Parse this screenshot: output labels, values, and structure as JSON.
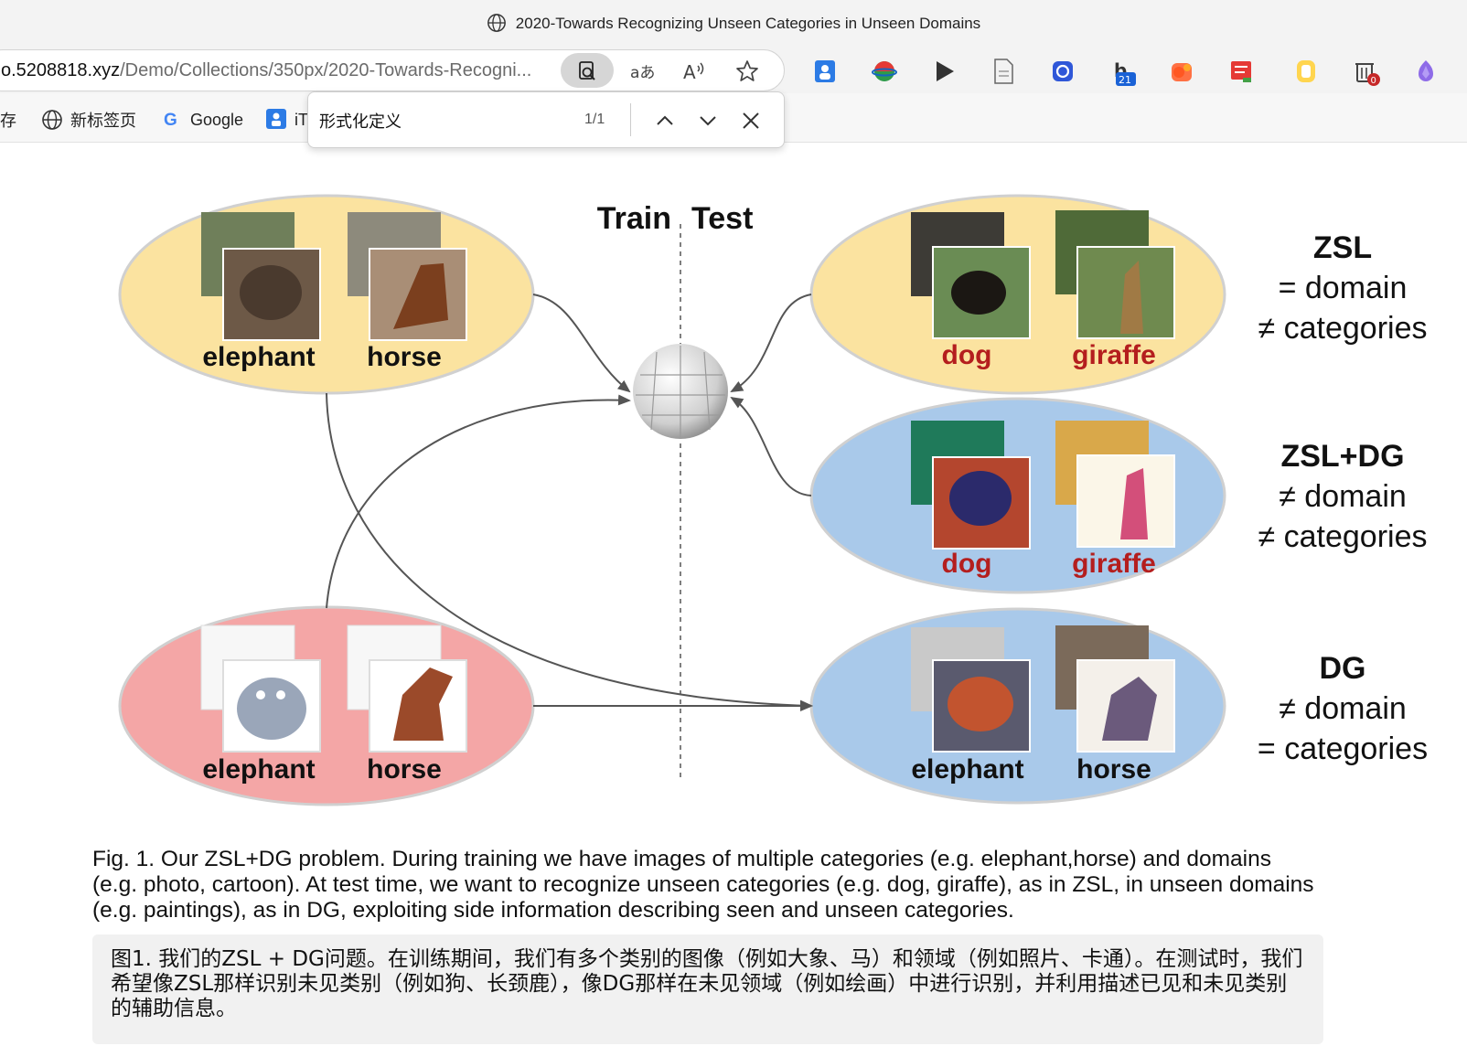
{
  "window": {
    "title": "2020-Towards Recognizing Unseen Categories in Unseen Domains",
    "title_icon": "globe-icon"
  },
  "address_bar": {
    "url_host": "o.5208818.xyz",
    "url_path": "/Demo/Collections/350px/2020-Towards-Recogni...",
    "icons": [
      "find-on-page-icon",
      "translate-icon",
      "read-aloud-icon",
      "favorite-star-icon"
    ]
  },
  "extensions": {
    "icons": [
      "person-ext-icon",
      "colorful-globe-ext-icon",
      "play-ext-icon",
      "document-ext-icon",
      "blue-chat-ext-icon",
      "b-badge-ext-icon",
      "orange-ext-icon",
      "red-list-ext-icon",
      "yellow-square-ext-icon",
      "trash-ext-icon",
      "purple-gem-ext-icon"
    ],
    "b_badge_count": "21",
    "trash_badge_count": "0",
    "badge_color": "#1a62d6",
    "trash_badge_color": "#c62828"
  },
  "bookmarks": {
    "items": [
      {
        "label": "存",
        "icon": ""
      },
      {
        "label": "新标签页",
        "icon": "globe-icon"
      },
      {
        "label": "Google",
        "icon": "google-g-icon"
      },
      {
        "label": "iT",
        "icon": "app-icon"
      }
    ]
  },
  "find_bar": {
    "query": "形式化定义",
    "match_count": "1/1",
    "icons": [
      "previous-match-icon",
      "next-match-icon",
      "close-find-icon"
    ]
  },
  "figure": {
    "train_label": "Train",
    "test_label": "Test",
    "train_photo": {
      "labels": [
        "elephant",
        "horse"
      ],
      "color": "#fbe3a0"
    },
    "train_cartoon": {
      "labels": [
        "elephant",
        "horse"
      ],
      "color": "#f4a6a6"
    },
    "test_zsl": {
      "labels": [
        "dog",
        "giraffe"
      ],
      "color": "#fbe3a0",
      "label_color": "#b41e1e"
    },
    "test_zsldg": {
      "labels": [
        "dog",
        "giraffe"
      ],
      "color": "#a9c9ea",
      "label_color": "#b41e1e"
    },
    "test_dg": {
      "labels": [
        "elephant",
        "horse"
      ],
      "color": "#a9c9ea",
      "label_color": "#111111"
    },
    "side_labels": [
      {
        "title": "ZSL",
        "line1": "= domain",
        "line2": "≠ categories"
      },
      {
        "title": "ZSL+DG",
        "line1": "≠ domain",
        "line2": "≠ categories"
      },
      {
        "title": "DG",
        "line1": "≠ domain",
        "line2": "= categories"
      }
    ]
  },
  "caption_en": "Fig. 1. Our ZSL+DG problem. During training we have images of multiple categories (e.g. elephant,horse) and domains (e.g. photo, cartoon). At test time, we want to recognize unseen categories (e.g. dog, giraffe), as in ZSL, in unseen domains (e.g. paintings), as in DG, exploiting side information describing seen and unseen categories.",
  "caption_zh": "图1. 我们的ZSL + DG问题。在训练期间，我们有多个类别的图像（例如大象、马）和领域（例如照片、卡通）。在测试时，我们希望像ZSL那样识别未见类别（例如狗、长颈鹿），像DG那样在未见领域（例如绘画）中进行识别，并利用描述已见和未见类别的辅助信息。"
}
